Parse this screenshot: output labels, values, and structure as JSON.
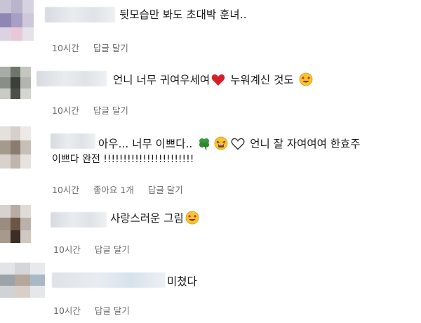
{
  "comments": [
    {
      "text": "뒷모습만 봐도 초대박 훈녀..",
      "time": "10시간",
      "reply": "답글 달기"
    },
    {
      "text_before": "언니 너무 귀여우세여",
      "text_mid": " 누워계신 것도 ",
      "time": "10시간",
      "reply": "답글 달기"
    },
    {
      "text_before": "아우... 너무 이쁘다..",
      "text_after": "언니 잘 자여여여 한효주",
      "line2": "이쁘다 완전 !!!!!!!!!!!!!!!!!!!!!!!",
      "time": "10시간",
      "likes": "좋아요 1개",
      "reply": "답글 달기"
    },
    {
      "text_before": "사랑스러운 그림",
      "time": "10시간",
      "reply": "답글 달기"
    },
    {
      "text_before": "미쳤다",
      "time": "10시간",
      "reply": "답글 달기"
    }
  ],
  "icons": {
    "heart": "red-heart-icon",
    "heart_eyes": "heart-eyes-emoji-icon",
    "clover": "clover-icon",
    "sleepy": "tired-face-emoji-icon",
    "heart_outline": "white-heart-icon"
  }
}
